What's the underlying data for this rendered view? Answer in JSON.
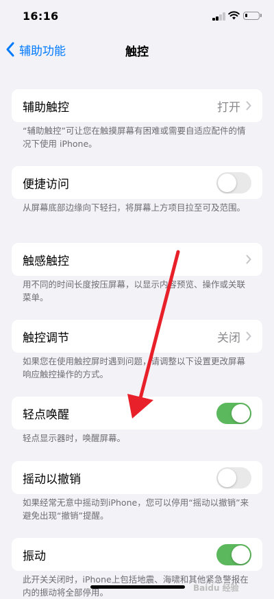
{
  "status_bar": {
    "time": "16:16"
  },
  "nav": {
    "back_label": "辅助功能",
    "title": "触控"
  },
  "settings": [
    {
      "label": "辅助触控",
      "value": "打开",
      "footer": "“辅助触控”可让您在触摸屏幕有困难或需要自适应配件的情况下使用 iPhone。"
    },
    {
      "label": "便捷访问",
      "toggle": "off",
      "footer": "从屏幕底部边缘向下轻扫，将屏幕上方项目拉至可及范围。"
    },
    {
      "label": "触感触控",
      "footer": "用不同的时间长度按压屏幕，以显示内容预览、操作或关联菜单。"
    },
    {
      "label": "触控调节",
      "value": "关闭",
      "footer": "如果您在使用触控屏时遇到问题，请调整以下设置更改屏幕响应触控操作的方式。"
    },
    {
      "label": "轻点唤醒",
      "toggle": "on",
      "footer": "轻点显示器时，唤醒屏幕。"
    },
    {
      "label": "摇动以撤销",
      "toggle": "off",
      "footer": "如果经常无意中摇动到iPhone，您可以停用“摇动以撤销”来避免出现“撤销”提醒。"
    },
    {
      "label": "振动",
      "toggle": "on",
      "footer": "此开关关闭时，iPhone上包括地震、海啸和其他紧急警报在内的振动将全部停用。"
    }
  ],
  "watermark": "Baidu 经验",
  "colors": {
    "accent": "#007aff",
    "toggle_on": "#5cb85c",
    "annotation_arrow": "#e8202a"
  }
}
